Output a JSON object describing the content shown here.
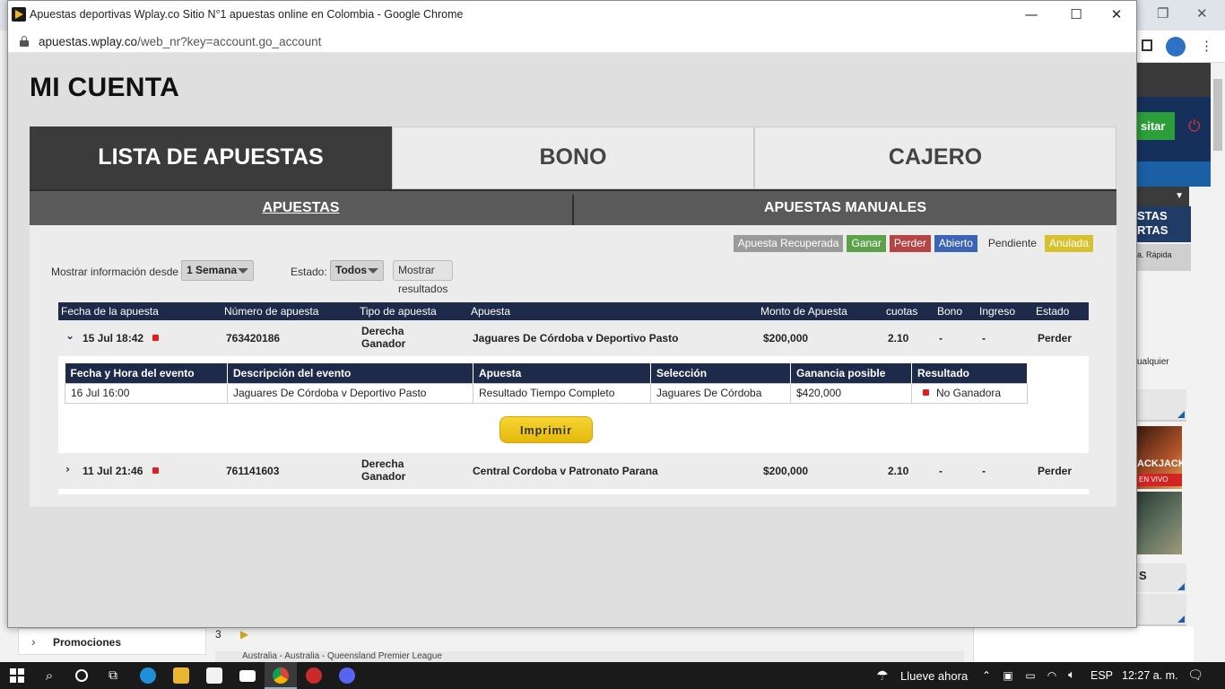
{
  "window": {
    "title": "Apuestas deportivas Wplay.co Sitio N°1 apuestas online en Colombia - Google Chrome",
    "url_domain": "apuestas.wplay.co",
    "url_path": "/web_nr?key=account.go_account",
    "minimize": "—",
    "maximize": "☐",
    "close": "✕"
  },
  "page": {
    "title": "MI CUENTA",
    "tabs": [
      {
        "label": "LISTA DE APUESTAS",
        "active": true
      },
      {
        "label": "BONO",
        "active": false
      },
      {
        "label": "CAJERO",
        "active": false
      }
    ],
    "subtabs": [
      {
        "label": "APUESTAS",
        "active": true
      },
      {
        "label": "APUESTAS MANUALES",
        "active": false
      }
    ]
  },
  "legend": [
    {
      "label": "Apuesta Recuperada",
      "color": "#9a9a9a"
    },
    {
      "label": "Ganar",
      "color": "#5ca24a"
    },
    {
      "label": "Perder",
      "color": "#b54444"
    },
    {
      "label": "Abierto",
      "color": "#3c64b5"
    },
    {
      "label": "Pendiente",
      "color": "transparent"
    },
    {
      "label": "Anulada",
      "color": "#d8c12e"
    }
  ],
  "filters": {
    "period_label": "Mostrar información desde",
    "period_value": "1 Semana",
    "state_label": "Estado:",
    "state_value": "Todos",
    "show_button": "Mostrar resultados"
  },
  "bets_table": {
    "headers": [
      "Fecha de la apuesta",
      "Número de apuesta",
      "Tipo de apuesta",
      "Apuesta",
      "Monto de Apuesta",
      "cuotas",
      "Bono",
      "Ingreso",
      "Estado"
    ],
    "rows": [
      {
        "date": "15 Jul 18:42",
        "number": "763420186",
        "type_line1": "Derecha",
        "type_line2": "Ganador",
        "bet": "Jaguares De Córdoba v Deportivo Pasto",
        "amount": "$200,000",
        "odds": "2.10",
        "bonus": "-",
        "income": "-",
        "state": "Perder",
        "expanded": true
      },
      {
        "date": "11 Jul 21:46",
        "number": "761141603",
        "type_line1": "Derecha",
        "type_line2": "Ganador",
        "bet": "Central Cordoba v Patronato Parana",
        "amount": "$200,000",
        "odds": "2.10",
        "bonus": "-",
        "income": "-",
        "state": "Perder",
        "expanded": false
      }
    ]
  },
  "detail_table": {
    "headers": [
      "Fecha y Hora del evento",
      "Descripción del evento",
      "Apuesta",
      "Selección",
      "Ganancia posible",
      "Resultado"
    ],
    "row": {
      "datetime": "16 Jul 16:00",
      "description": "Jaguares De Córdoba v Deportivo Pasto",
      "bet": "Resultado Tiempo Completo",
      "selection": "Jaguares De Córdoba",
      "potential": "$420,000",
      "result": "No Ganadora"
    },
    "print_button": "Imprimir"
  },
  "background": {
    "help": "?",
    "deposit_btn": "sitar",
    "apuestas_label_1": "STAS",
    "apuestas_label_2": "RTAS",
    "rapida": "a. Rápida",
    "side_text": "ualquier",
    "blackjack": "ACKJACK",
    "live": "EN VIVO",
    "s_label": "S",
    "promociones": "Promociones",
    "mid_num": "3",
    "league": "Australia - Australia - Queensland Premier League"
  },
  "taskbar": {
    "weather": "Llueve ahora",
    "lang": "ESP",
    "time": "12:27 a. m."
  }
}
